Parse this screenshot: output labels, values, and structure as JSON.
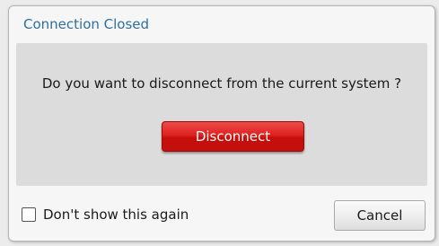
{
  "dialog": {
    "title": "Connection Closed",
    "message": "Do you want to disconnect from the current system ?",
    "primary_button_label": "Disconnect",
    "cancel_button_label": "Cancel",
    "checkbox": {
      "label": "Don't show this again",
      "checked": false
    }
  },
  "colors": {
    "title": "#2f6f9f",
    "primary_button": "#dd2320",
    "content_panel": "#dcdcdc",
    "dialog_background": "#f6f6f6"
  }
}
